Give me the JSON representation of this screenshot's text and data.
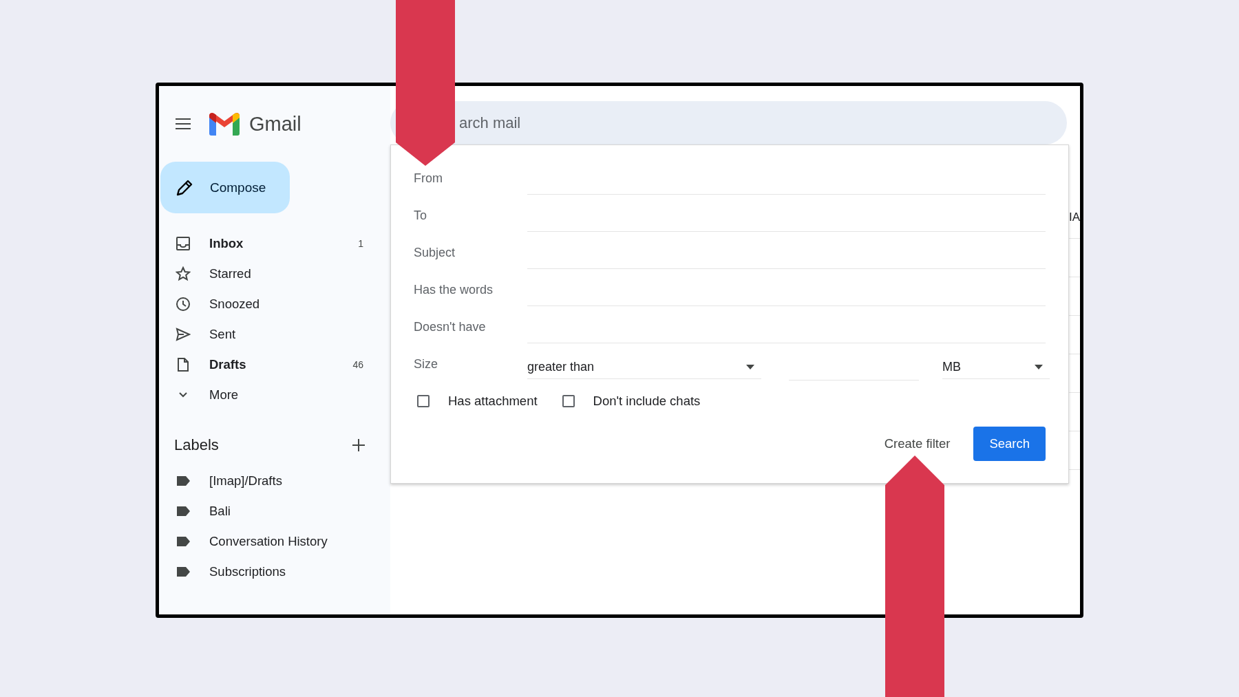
{
  "header": {
    "app_name": "Gmail"
  },
  "compose": {
    "label": "Compose"
  },
  "nav": [
    {
      "kind": "inbox",
      "label": "Inbox",
      "count": "1",
      "unread": true
    },
    {
      "kind": "star",
      "label": "Starred",
      "unread": false
    },
    {
      "kind": "clock",
      "label": "Snoozed",
      "unread": false
    },
    {
      "kind": "send",
      "label": "Sent",
      "unread": false
    },
    {
      "kind": "file",
      "label": "Drafts",
      "count": "46",
      "unread": true
    },
    {
      "kind": "chevron",
      "label": "More",
      "unread": false
    }
  ],
  "labels": {
    "title": "Labels",
    "items": [
      "[Imap]/Drafts",
      "Bali",
      "Conversation History",
      "Subscriptions"
    ]
  },
  "search": {
    "placeholder": "arch mail"
  },
  "background_rows": [
    {
      "column_3": "IA"
    }
  ],
  "search_options": {
    "fields": [
      {
        "label": "From"
      },
      {
        "label": "To"
      },
      {
        "label": "Subject"
      },
      {
        "label": "Has the words"
      },
      {
        "label": "Doesn't have"
      }
    ],
    "size": {
      "label": "Size",
      "comparison": "greater than",
      "unit": "MB"
    },
    "checkboxes": [
      {
        "label": "Has attachment",
        "checked": false
      },
      {
        "label": "Don't include chats",
        "checked": false
      }
    ],
    "buttons": [
      {
        "label": "Create filter",
        "kind": "text"
      },
      {
        "label": "Search",
        "kind": "primary"
      }
    ]
  },
  "annotations": [
    {
      "kind": "arrow_down"
    },
    {
      "kind": "arrow_up"
    }
  ]
}
